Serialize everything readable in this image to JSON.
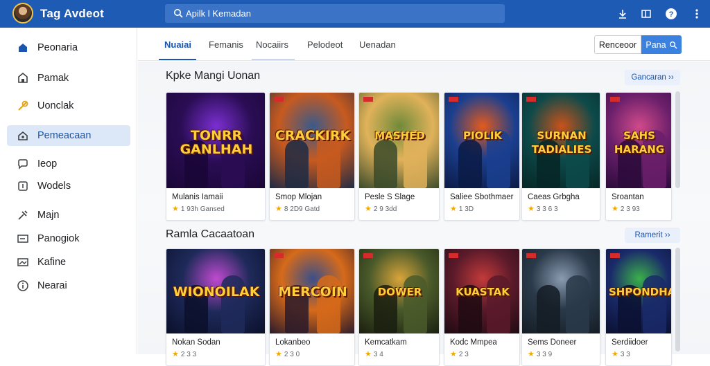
{
  "app": {
    "title": "Tag Avdeot"
  },
  "search": {
    "placeholder": "Apilk l Kemadan"
  },
  "sidebar": {
    "items": [
      {
        "label": "Peonaria",
        "icon": "home-icon"
      },
      {
        "label": "Pamak",
        "icon": "store-icon"
      },
      {
        "label": "Uonclak",
        "icon": "tag-icon"
      },
      {
        "label": "Pemeacaan",
        "icon": "gamepad-icon",
        "active": true
      },
      {
        "label": "Ieop",
        "icon": "chat-icon"
      },
      {
        "label": "Wodels",
        "icon": "grid-icon"
      },
      {
        "label": "Majn",
        "icon": "tools-icon"
      },
      {
        "label": "Panogiok",
        "icon": "card-icon"
      },
      {
        "label": "Kafine",
        "icon": "photo-icon"
      },
      {
        "label": "Nearai",
        "icon": "info-icon"
      }
    ]
  },
  "tabs": [
    {
      "label": "Nuaiai",
      "active": true
    },
    {
      "label": "Femanis"
    },
    {
      "label": "Nocaiirs"
    },
    {
      "label": "Pelodeot"
    },
    {
      "label": "Uenadan"
    }
  ],
  "actions": {
    "outline_label": "Renceoor",
    "primary_label": "Pana"
  },
  "sections": [
    {
      "title": "Kpke Mangi Uonan",
      "see_more": "Gancaran",
      "cards": [
        {
          "art": "TONRR GANLHAH",
          "name": "Mulanis Iamaii",
          "rating": "1 93h Gansed",
          "colors": [
            "#2a0d54",
            "#7b2fd1",
            "#1a0636"
          ]
        },
        {
          "art": "CRACKIRK",
          "name": "Smop Mlojan",
          "rating": "8 2D9 Gatd",
          "colors": [
            "#c75a1f",
            "#3a5a8a",
            "#1d2a44"
          ]
        },
        {
          "art": "MASHED",
          "name": "Pesle S Slage",
          "rating": "2 9 3dd",
          "colors": [
            "#e0b25a",
            "#6f8a3a",
            "#3a4a2a"
          ]
        },
        {
          "art": "PIOLIK",
          "name": "Saliee Sbothmaer",
          "rating": "1 3D",
          "colors": [
            "#1b3f8f",
            "#e45a1c",
            "#0b1a44"
          ]
        },
        {
          "art": "SURNAN TADIALIES",
          "name": "Caeas Grbgha",
          "rating": "3 3 6 3",
          "colors": [
            "#0d4a4a",
            "#c9521a",
            "#062626"
          ]
        },
        {
          "art": "SAHS HARANG",
          "name": "Sroantan",
          "rating": "2 3 93",
          "colors": [
            "#6b1f6b",
            "#d04a8a",
            "#2a0b3a"
          ]
        }
      ]
    },
    {
      "title": "Ramla Cacaatoan",
      "see_more": "Ramerit",
      "cards": [
        {
          "art": "WIONOILAK",
          "name": "Nokan Sodan",
          "rating": "2 3 3",
          "colors": [
            "#1e2a5a",
            "#c04ad0",
            "#0a0f2a"
          ]
        },
        {
          "art": "MERCOIN",
          "name": "Lokanbeo",
          "rating": "2 3 0",
          "colors": [
            "#d66a1a",
            "#3a4f8a",
            "#2a1a2a"
          ]
        },
        {
          "art": "DOWER",
          "name": "Kemcatkam",
          "rating": "3 4",
          "colors": [
            "#4a5a2a",
            "#d9a43a",
            "#1a1f0f"
          ]
        },
        {
          "art": "KUASTAK",
          "name": "Kodc Mmpea",
          "rating": "2 3",
          "colors": [
            "#5a1a2a",
            "#c23a3a",
            "#1f0a12"
          ]
        },
        {
          "art": "",
          "name": "Sems Doneer",
          "rating": "3 3 9",
          "colors": [
            "#2a3a4a",
            "#8a9ab0",
            "#141c24"
          ]
        },
        {
          "art": "SHPONDHAK",
          "name": "Serdiidoer",
          "rating": "3 3",
          "colors": [
            "#1a2a6a",
            "#3ab04a",
            "#0a1030"
          ]
        }
      ]
    }
  ],
  "accent": "#1e5bb5"
}
